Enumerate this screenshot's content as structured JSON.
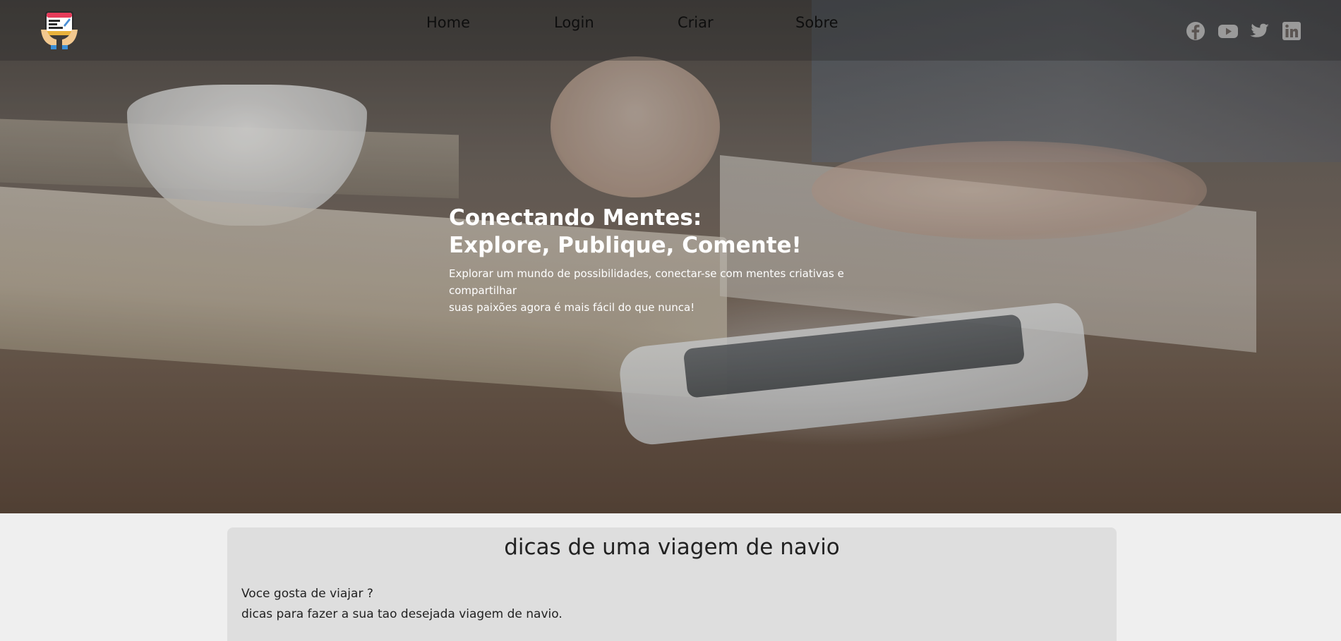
{
  "nav": {
    "items": [
      {
        "label": "Home"
      },
      {
        "label": "Login"
      },
      {
        "label": "Criar"
      },
      {
        "label": "Sobre"
      }
    ]
  },
  "social": [
    {
      "icon": "facebook-icon"
    },
    {
      "icon": "youtube-icon"
    },
    {
      "icon": "twitter-icon"
    },
    {
      "icon": "linkedin-icon"
    }
  ],
  "hero": {
    "title_line1": "Conectando Mentes:",
    "title_line2": "Explore, Publique, Comente!",
    "subtitle_line1": "Explorar um mundo de possibilidades, conectar-se com mentes criativas e compartilhar",
    "subtitle_line2": "suas paixões agora é mais fácil do que nunca!"
  },
  "post": {
    "title": "dicas de uma viagem de navio",
    "line1": "Voce gosta de viajar ?",
    "line2": "dicas para fazer a sua tao desejada viagem de navio."
  },
  "colors": {
    "nav_text": "#0e0e0e",
    "social_icon": "#9a9a9a",
    "post_bg": "#dedede",
    "page_bg": "#efefef"
  }
}
